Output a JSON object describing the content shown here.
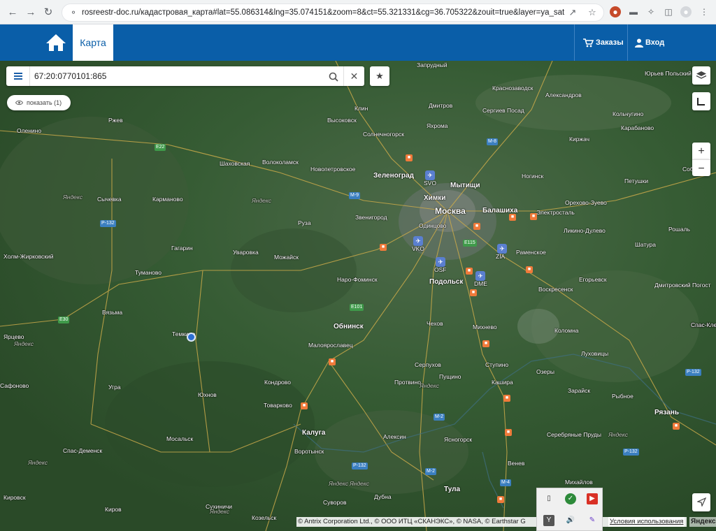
{
  "browser": {
    "url": "rosreestr-doc.ru/кадастровая_карта#lat=55.086314&lng=35.074151&zoom=8&ct=55.321331&cg=36.705322&zouit=true&layer=ya_sat"
  },
  "header": {
    "tab_map": "Карта",
    "orders_label": "Заказы",
    "login_label": "Вход"
  },
  "search": {
    "value": "67:20:0770101:865"
  },
  "show_button": {
    "label": "показать (1)"
  },
  "zoom": {
    "in": "+",
    "out": "−"
  },
  "map": {
    "labels": [
      {
        "t": "Запрудный",
        "c": ""
      },
      {
        "t": "Юрьев Польский",
        "c": ""
      },
      {
        "t": "Краснозаводск",
        "c": ""
      },
      {
        "t": "Александров",
        "c": ""
      },
      {
        "t": "Клин",
        "c": ""
      },
      {
        "t": "Дмитров",
        "c": ""
      },
      {
        "t": "Сергиев Посад",
        "c": ""
      },
      {
        "t": "Кольчугино",
        "c": ""
      },
      {
        "t": "Ржев",
        "c": ""
      },
      {
        "t": "Высоковск",
        "c": ""
      },
      {
        "t": "Яхрома",
        "c": ""
      },
      {
        "t": "Карабаново",
        "c": ""
      },
      {
        "t": "Оленино",
        "c": ""
      },
      {
        "t": "Солнечногорск",
        "c": ""
      },
      {
        "t": "Киржач",
        "c": ""
      },
      {
        "t": "Шаховская",
        "c": ""
      },
      {
        "t": "Волоколамск",
        "c": ""
      },
      {
        "t": "Новопетровское",
        "c": ""
      },
      {
        "t": "Зеленоград",
        "c": "big"
      },
      {
        "t": "Мытищи",
        "c": "big"
      },
      {
        "t": "Ногинск",
        "c": ""
      },
      {
        "t": "Петушки",
        "c": ""
      },
      {
        "t": "Сычевка",
        "c": ""
      },
      {
        "t": "Карманово",
        "c": ""
      },
      {
        "t": "Химки",
        "c": "big"
      },
      {
        "t": "Москва",
        "c": "cap"
      },
      {
        "t": "Балашиха",
        "c": "big"
      },
      {
        "t": "Электросталь",
        "c": ""
      },
      {
        "t": "Орехово-Зуево",
        "c": ""
      },
      {
        "t": "Звенигород",
        "c": ""
      },
      {
        "t": "Одинцово",
        "c": ""
      },
      {
        "t": "Руза",
        "c": ""
      },
      {
        "t": "Ликино-Дулево",
        "c": ""
      },
      {
        "t": "Рошаль",
        "c": ""
      },
      {
        "t": "Гагарин",
        "c": ""
      },
      {
        "t": "Уваровка",
        "c": ""
      },
      {
        "t": "Раменское",
        "c": ""
      },
      {
        "t": "Шатура",
        "c": ""
      },
      {
        "t": "Холм-Жирковский",
        "c": ""
      },
      {
        "t": "Можайск",
        "c": ""
      },
      {
        "t": "Туманово",
        "c": ""
      },
      {
        "t": "Наро-Фоминск",
        "c": ""
      },
      {
        "t": "Подольск",
        "c": "big"
      },
      {
        "t": "Егорьевск",
        "c": ""
      },
      {
        "t": "Воскресенск",
        "c": ""
      },
      {
        "t": "Дмитровский Погост",
        "c": ""
      },
      {
        "t": "Вязьма",
        "c": ""
      },
      {
        "t": "Спас-Клепики",
        "c": ""
      },
      {
        "t": "Обнинск",
        "c": "big"
      },
      {
        "t": "Чехов",
        "c": ""
      },
      {
        "t": "Михнево",
        "c": ""
      },
      {
        "t": "Коломна",
        "c": ""
      },
      {
        "t": "Темкино",
        "c": ""
      },
      {
        "t": "Малоярославец",
        "c": ""
      },
      {
        "t": "Луховицы",
        "c": ""
      },
      {
        "t": "Серпухов",
        "c": ""
      },
      {
        "t": "Ступино",
        "c": ""
      },
      {
        "t": "Озеры",
        "c": ""
      },
      {
        "t": "Пущино",
        "c": ""
      },
      {
        "t": "Кондрово",
        "c": ""
      },
      {
        "t": "Протвино",
        "c": ""
      },
      {
        "t": "Кашира",
        "c": ""
      },
      {
        "t": "Угра",
        "c": ""
      },
      {
        "t": "Зарайск",
        "c": ""
      },
      {
        "t": "Рыбное",
        "c": ""
      },
      {
        "t": "Юхнов",
        "c": ""
      },
      {
        "t": "Товарково",
        "c": ""
      },
      {
        "t": "Рязань",
        "c": "big"
      },
      {
        "t": "Калуга",
        "c": "big"
      },
      {
        "t": "Алексин",
        "c": ""
      },
      {
        "t": "Серебряные Пруды",
        "c": ""
      },
      {
        "t": "Мосальск",
        "c": ""
      },
      {
        "t": "Ясногорск",
        "c": ""
      },
      {
        "t": "Спас-Деменск",
        "c": ""
      },
      {
        "t": "Воротынск",
        "c": ""
      },
      {
        "t": "Венев",
        "c": ""
      },
      {
        "t": "Тула",
        "c": "big"
      },
      {
        "t": "Михайлов",
        "c": ""
      },
      {
        "t": "Кировск",
        "c": ""
      },
      {
        "t": "Суворов",
        "c": ""
      },
      {
        "t": "Дубна",
        "c": ""
      },
      {
        "t": "Сухиничи",
        "c": ""
      },
      {
        "t": "Киров",
        "c": ""
      },
      {
        "t": "Козельск",
        "c": ""
      },
      {
        "t": "Ярцево",
        "c": ""
      },
      {
        "t": "Сафоново",
        "c": ""
      },
      {
        "t": "Собинка",
        "c": ""
      },
      {
        "t": "Спас-Клепики",
        "c": ""
      }
    ],
    "shields": [
      {
        "t": "Е22",
        "c": "green"
      },
      {
        "t": "М-8",
        "c": ""
      },
      {
        "t": "М-9",
        "c": ""
      },
      {
        "t": "Р-132",
        "c": ""
      },
      {
        "t": "Е115",
        "c": "green"
      },
      {
        "t": "Е101",
        "c": "green"
      },
      {
        "t": "Е30",
        "c": "green"
      },
      {
        "t": "М-2",
        "c": ""
      },
      {
        "t": "Р-132",
        "c": ""
      },
      {
        "t": "Р-132",
        "c": ""
      },
      {
        "t": "М-2",
        "c": ""
      },
      {
        "t": "М-4",
        "c": ""
      },
      {
        "t": "Р-132",
        "c": ""
      }
    ],
    "airports": [
      {
        "t": "SVO"
      },
      {
        "t": "VKO"
      },
      {
        "t": "OSF"
      },
      {
        "t": "ZIA"
      },
      {
        "t": "DME"
      }
    ],
    "watermark": "Яндекс"
  },
  "attribution": {
    "text": "© Antrix Corporation Ltd., © ООО ИТЦ «СКАНЭКС», © NASA, © Earthstar G",
    "terms": "Условия использования",
    "logo": "Яндекс"
  }
}
